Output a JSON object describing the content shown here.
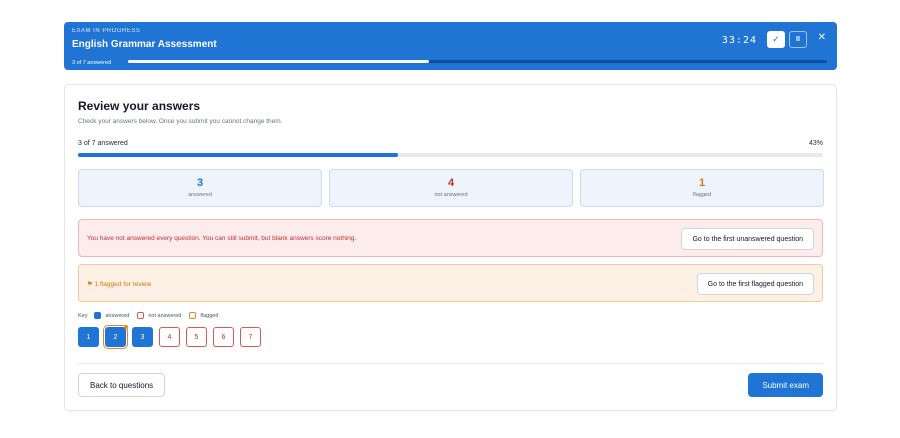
{
  "header": {
    "eyebrow": "EXAM IN PROGRESS",
    "title": "English Grammar Assessment",
    "timer": "33:24",
    "check_icon": "check-icon",
    "pause_icon": "pause-icon",
    "close_icon": "close-icon",
    "progress_label": "3 of 7 answered",
    "progress_fraction": 0.43
  },
  "review": {
    "title": "Review your answers",
    "subtitle": "Check your answers below. Once you submit you cannot change them.",
    "progress_label": "3 of 7 answered",
    "progress_percent": "43%",
    "progress_fraction": 0.43
  },
  "stats": [
    {
      "value": "3",
      "label": "answered",
      "color": "#1f74d4"
    },
    {
      "value": "4",
      "label": "not answered",
      "color": "#c53030"
    },
    {
      "value": "1",
      "label": "flagged",
      "color": "#d97706"
    }
  ],
  "alerts": {
    "unanswered_text": "You have not answered every question. You can still submit, but blank answers score nothing.",
    "unanswered_button": "Go to the first unanswered question",
    "flagged_text": "1 flagged for review",
    "flagged_icon": "flag-icon",
    "flagged_button": "Go to the first flagged question"
  },
  "key": {
    "label": "Key",
    "answered": "answered",
    "not_answered": "not answered",
    "flagged": "flagged"
  },
  "questions": [
    {
      "number": "1",
      "status": "answered",
      "flagged": false
    },
    {
      "number": "2",
      "status": "answered",
      "flagged": true
    },
    {
      "number": "3",
      "status": "answered",
      "flagged": false
    },
    {
      "number": "4",
      "status": "not-answered",
      "flagged": false
    },
    {
      "number": "5",
      "status": "not-answered",
      "flagged": false
    },
    {
      "number": "6",
      "status": "not-answered",
      "flagged": false
    },
    {
      "number": "7",
      "status": "not-answered",
      "flagged": false
    }
  ],
  "footer": {
    "back_label": "Back to questions",
    "submit_label": "Submit exam"
  },
  "colors": {
    "primary": "#1f74d4",
    "danger": "#c53030",
    "warning": "#d97706"
  }
}
